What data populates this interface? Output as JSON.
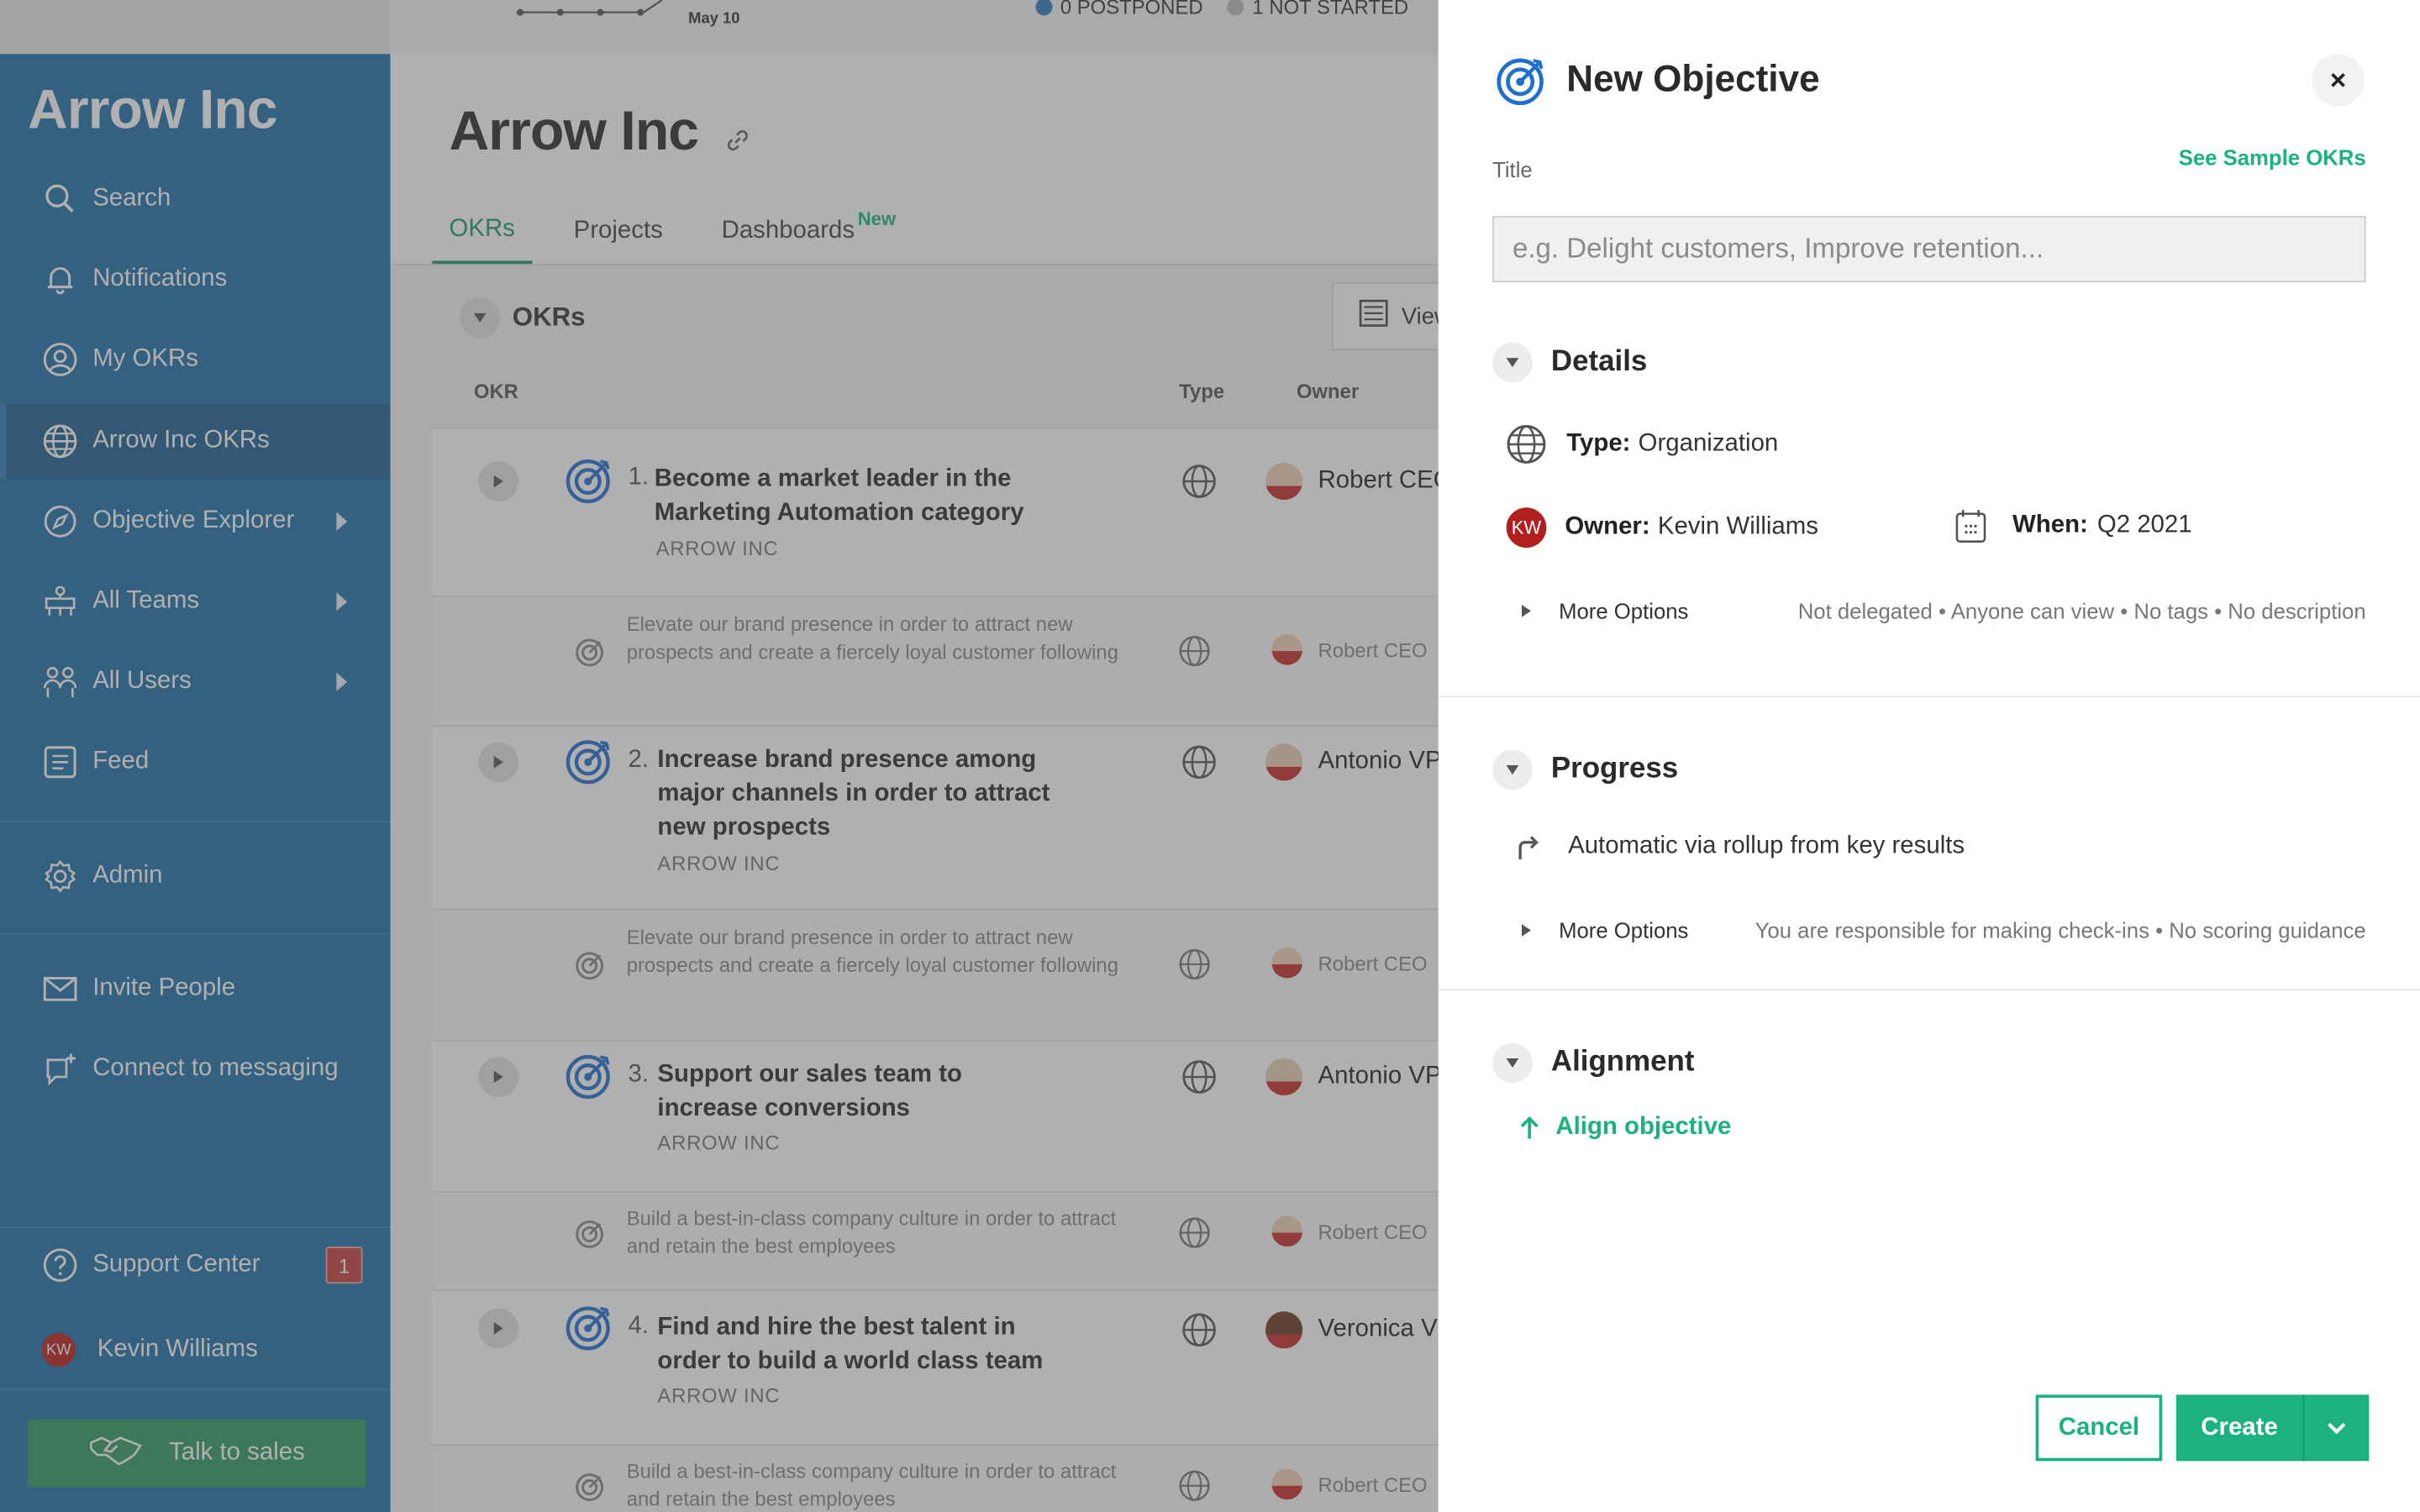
{
  "colors": {
    "sidebar": "#1f6fa8",
    "accent": "#1bb27d",
    "goal_blue": "#1f6fcf",
    "badge_red": "#c94141"
  },
  "topbar": {
    "chart_date": "May 10",
    "postponed": "0 POSTPONED",
    "not_started": "1 NOT STARTED"
  },
  "sidebar": {
    "brand": "Arrow Inc",
    "items": [
      {
        "label": "Search",
        "icon": "search-icon"
      },
      {
        "label": "Notifications",
        "icon": "bell-icon"
      },
      {
        "label": "My OKRs",
        "icon": "user-circle-icon"
      },
      {
        "label": "Arrow Inc OKRs",
        "icon": "globe-icon",
        "active": true
      },
      {
        "label": "Objective Explorer",
        "icon": "compass-icon",
        "expandable": true
      },
      {
        "label": "All Teams",
        "icon": "teams-icon",
        "expandable": true
      },
      {
        "label": "All Users",
        "icon": "users-icon",
        "expandable": true
      },
      {
        "label": "Feed",
        "icon": "feed-icon"
      },
      {
        "label": "Admin",
        "icon": "gear-icon"
      },
      {
        "label": "Invite People",
        "icon": "mail-icon"
      },
      {
        "label": "Connect to messaging",
        "icon": "chat-plus-icon"
      },
      {
        "label": "Support Center",
        "icon": "help-icon",
        "badge": "1"
      },
      {
        "label": "Kevin Williams",
        "icon": "avatar",
        "initials": "KW"
      }
    ],
    "talk_to_sales": "Talk to sales"
  },
  "main": {
    "title": "Arrow Inc",
    "tabs": [
      {
        "label": "OKRs",
        "active": true
      },
      {
        "label": "Projects"
      },
      {
        "label": "Dashboards",
        "badge": "New"
      }
    ],
    "section_title": "OKRs",
    "view_button": "View",
    "columns": {
      "okr": "OKR",
      "type": "Type",
      "owner": "Owner"
    },
    "rows": [
      {
        "num": "1.",
        "title": "Become a market leader in the Marketing Automation category",
        "org": "ARROW INC",
        "owner": "Robert CEO"
      },
      {
        "sub": "Elevate our brand presence in order to attract new prospects and create a fiercely loyal customer following",
        "owner": "Robert CEO"
      },
      {
        "num": "2.",
        "title": "Increase brand presence among major channels in order to attract new prospects",
        "org": "ARROW INC",
        "owner": "Antonio VP"
      },
      {
        "sub": "Elevate our brand presence in order to attract new prospects and create a fiercely loyal customer following",
        "owner": "Robert CEO"
      },
      {
        "num": "3.",
        "title": "Support our sales team to increase conversions",
        "org": "ARROW INC",
        "owner": "Antonio VP"
      },
      {
        "sub": "Build a best-in-class company culture in order to attract and retain the best employees",
        "owner": "Robert CEO"
      },
      {
        "num": "4.",
        "title": "Find and hire the best talent in order to build a world class team",
        "org": "ARROW INC",
        "owner": "Veronica V"
      },
      {
        "sub": "Build a best-in-class company culture in order to attract and retain the best employees",
        "owner": "Robert CEO"
      }
    ]
  },
  "panel": {
    "title": "New Objective",
    "title_label": "Title",
    "see_samples": "See Sample OKRs",
    "title_placeholder": "e.g. Delight customers, Improve retention...",
    "details": {
      "heading": "Details",
      "type_label": "Type:",
      "type_value": "Organization",
      "owner_label": "Owner:",
      "owner_value": "Kevin Williams",
      "owner_initials": "KW",
      "when_label": "When:",
      "when_value": "Q2 2021",
      "more_options": "More Options",
      "meta": "Not delegated • Anyone can view • No tags • No description"
    },
    "progress": {
      "heading": "Progress",
      "mode": "Automatic via rollup from key results",
      "more_options": "More Options",
      "meta": "You are responsible for making check-ins • No scoring guidance"
    },
    "alignment": {
      "heading": "Alignment",
      "action": "Align objective"
    },
    "buttons": {
      "cancel": "Cancel",
      "create": "Create"
    }
  }
}
